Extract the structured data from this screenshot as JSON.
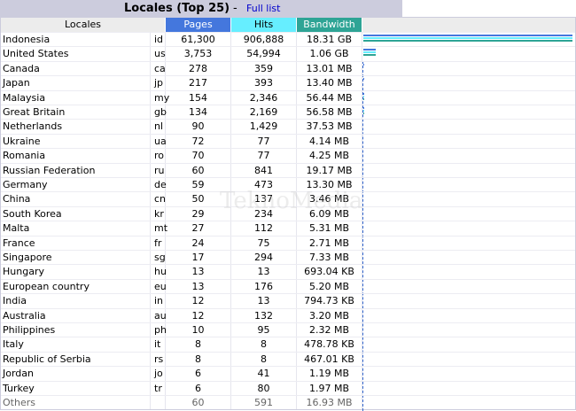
{
  "header": {
    "title": "Locales (Top 25)",
    "separator": "-",
    "full_list_label": "Full list"
  },
  "columns": {
    "locales": "Locales",
    "pages": "Pages",
    "hits": "Hits",
    "bandwidth": "Bandwidth"
  },
  "colors": {
    "pages": "#4477dd",
    "hits": "#66eeff",
    "bandwidth": "#2ea495",
    "title_bg": "#ccccdd"
  },
  "rows": [
    {
      "name": "Indonesia",
      "code": "id",
      "pages": "61,300",
      "hits": "906,888",
      "bandwidth": "18.31 GB"
    },
    {
      "name": "United States",
      "code": "us",
      "pages": "3,753",
      "hits": "54,994",
      "bandwidth": "1.06 GB"
    },
    {
      "name": "Canada",
      "code": "ca",
      "pages": "278",
      "hits": "359",
      "bandwidth": "13.01 MB"
    },
    {
      "name": "Japan",
      "code": "jp",
      "pages": "217",
      "hits": "393",
      "bandwidth": "13.40 MB"
    },
    {
      "name": "Malaysia",
      "code": "my",
      "pages": "154",
      "hits": "2,346",
      "bandwidth": "56.44 MB"
    },
    {
      "name": "Great Britain",
      "code": "gb",
      "pages": "134",
      "hits": "2,169",
      "bandwidth": "56.58 MB"
    },
    {
      "name": "Netherlands",
      "code": "nl",
      "pages": "90",
      "hits": "1,429",
      "bandwidth": "37.53 MB"
    },
    {
      "name": "Ukraine",
      "code": "ua",
      "pages": "72",
      "hits": "77",
      "bandwidth": "4.14 MB"
    },
    {
      "name": "Romania",
      "code": "ro",
      "pages": "70",
      "hits": "77",
      "bandwidth": "4.25 MB"
    },
    {
      "name": "Russian Federation",
      "code": "ru",
      "pages": "60",
      "hits": "841",
      "bandwidth": "19.17 MB"
    },
    {
      "name": "Germany",
      "code": "de",
      "pages": "59",
      "hits": "473",
      "bandwidth": "13.30 MB"
    },
    {
      "name": "China",
      "code": "cn",
      "pages": "50",
      "hits": "137",
      "bandwidth": "3.46 MB"
    },
    {
      "name": "South Korea",
      "code": "kr",
      "pages": "29",
      "hits": "234",
      "bandwidth": "6.09 MB"
    },
    {
      "name": "Malta",
      "code": "mt",
      "pages": "27",
      "hits": "112",
      "bandwidth": "5.31 MB"
    },
    {
      "name": "France",
      "code": "fr",
      "pages": "24",
      "hits": "75",
      "bandwidth": "2.71 MB"
    },
    {
      "name": "Singapore",
      "code": "sg",
      "pages": "17",
      "hits": "294",
      "bandwidth": "7.33 MB"
    },
    {
      "name": "Hungary",
      "code": "hu",
      "pages": "13",
      "hits": "13",
      "bandwidth": "693.04 KB"
    },
    {
      "name": "European country",
      "code": "eu",
      "pages": "13",
      "hits": "176",
      "bandwidth": "5.20 MB"
    },
    {
      "name": "India",
      "code": "in",
      "pages": "12",
      "hits": "13",
      "bandwidth": "794.73 KB"
    },
    {
      "name": "Australia",
      "code": "au",
      "pages": "12",
      "hits": "132",
      "bandwidth": "3.20 MB"
    },
    {
      "name": "Philippines",
      "code": "ph",
      "pages": "10",
      "hits": "95",
      "bandwidth": "2.32 MB"
    },
    {
      "name": "Italy",
      "code": "it",
      "pages": "8",
      "hits": "8",
      "bandwidth": "478.78 KB"
    },
    {
      "name": "Republic of Serbia",
      "code": "rs",
      "pages": "8",
      "hits": "8",
      "bandwidth": "467.01 KB"
    },
    {
      "name": "Jordan",
      "code": "jo",
      "pages": "6",
      "hits": "41",
      "bandwidth": "1.19 MB"
    },
    {
      "name": "Turkey",
      "code": "tr",
      "pages": "6",
      "hits": "80",
      "bandwidth": "1.97 MB"
    }
  ],
  "others": {
    "name": "Others",
    "pages": "60",
    "hits": "591",
    "bandwidth": "16.93 MB"
  },
  "watermark": "TeknoMedia"
}
